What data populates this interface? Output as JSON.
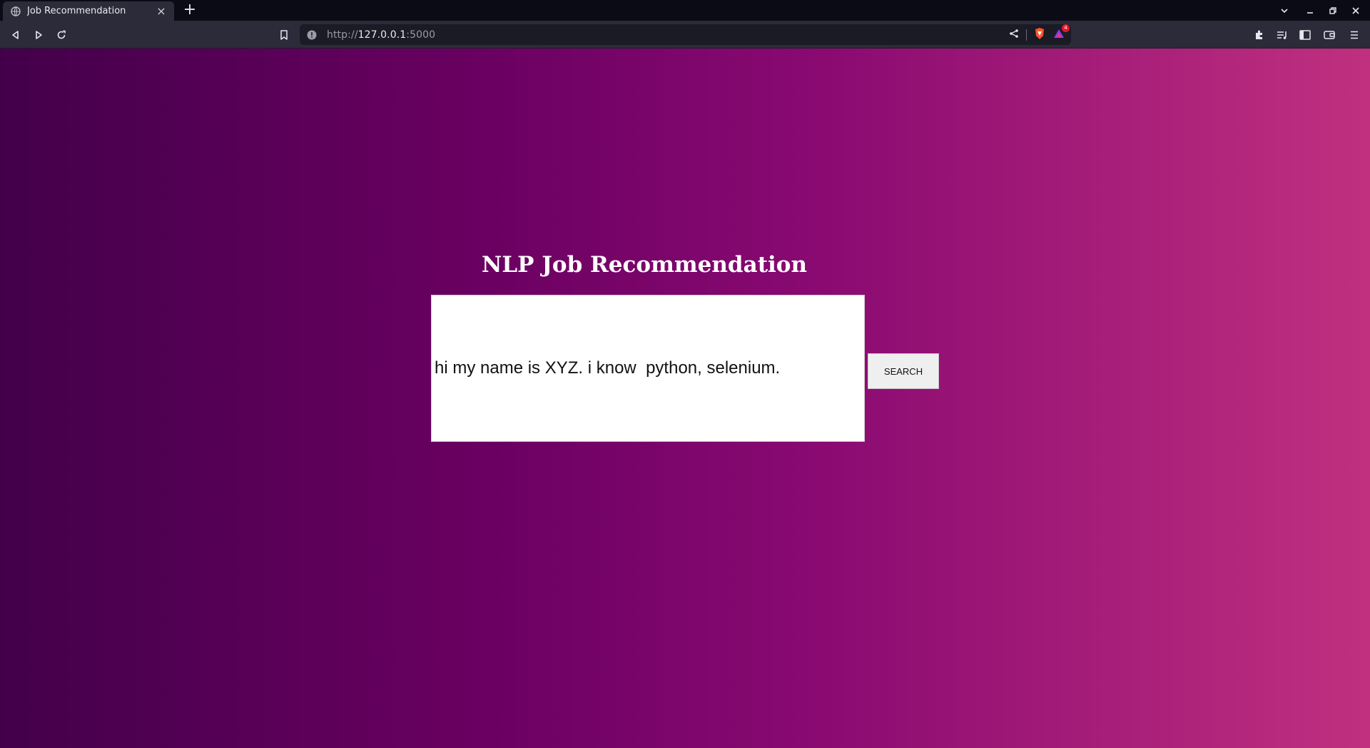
{
  "browser": {
    "tab_title": "Job Recommendation",
    "url_scheme": "http://",
    "url_host": "127.0.0.1",
    "url_port": ":5000",
    "shield_badge_count": "4"
  },
  "page": {
    "heading": "NLP Job Recommendation",
    "query_value": "hi my name is XYZ. i know  python, selenium.",
    "search_label": "SEARCH"
  },
  "colors": {
    "gradient_start": "#43004a",
    "gradient_end": "#c0307f",
    "chrome_bg": "#2b2b3a"
  }
}
